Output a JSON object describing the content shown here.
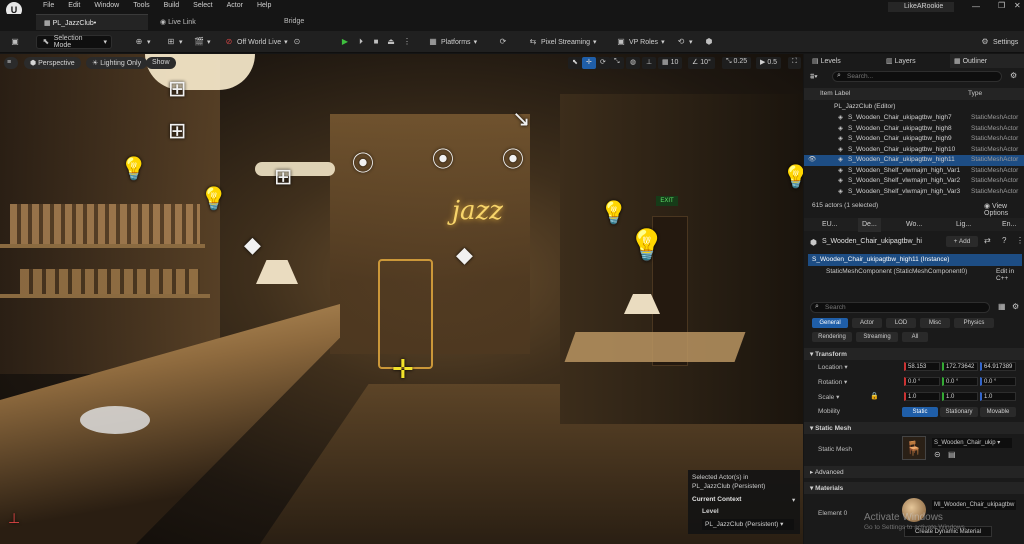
{
  "menu": [
    "File",
    "Edit",
    "Window",
    "Tools",
    "Build",
    "Select",
    "Actor",
    "Help"
  ],
  "window": {
    "project_label": "LikeARookie",
    "tab_level": "PL_JazzClub•",
    "tab_livelink": "Live Link",
    "tab_bridge": "Bridge"
  },
  "toolbar": {
    "selection_mode": "Selection Mode",
    "off_world": "Off World Live",
    "platforms": "Platforms",
    "pixel_streaming": "Pixel Streaming",
    "vp_roles": "VP Roles",
    "settings": "Settings"
  },
  "viewport": {
    "perspective": "Perspective",
    "lighting": "Lighting Only",
    "show": "Show",
    "grid": "10",
    "angle": "10°",
    "scale": "0.25",
    "speed": "0.5",
    "neon_text": "jazz",
    "exit_sign": "EXIT"
  },
  "panel_tabs": {
    "levels": "Levels",
    "layers": "Layers",
    "outliner": "Outliner"
  },
  "outliner": {
    "search_placeholder": "Search...",
    "col_label": "Item Label",
    "col_type": "Type",
    "root": "PL_JazzClub (Editor)",
    "items": [
      {
        "name": "S_Wooden_Chair_ukipagtbw_high7",
        "type": "StaticMeshActor"
      },
      {
        "name": "S_Wooden_Chair_ukipagtbw_high8",
        "type": "StaticMeshActor"
      },
      {
        "name": "S_Wooden_Chair_ukipagtbw_high9",
        "type": "StaticMeshActor"
      },
      {
        "name": "S_Wooden_Chair_ukipagtbw_high10",
        "type": "StaticMeshActor"
      },
      {
        "name": "S_Wooden_Chair_ukipagtbw_high11",
        "type": "StaticMeshActor"
      },
      {
        "name": "S_Wooden_Shelf_vlwmajm_high_Var1",
        "type": "StaticMeshActor"
      },
      {
        "name": "S_Wooden_Shelf_vlwmajm_high_Var2",
        "type": "StaticMeshActor"
      },
      {
        "name": "S_Wooden_Shelf_vlwmajm_high_Var3",
        "type": "StaticMeshActor"
      }
    ],
    "footer": "615 actors (1 selected)"
  },
  "details_tabs": [
    "EU...",
    "De...",
    "Wo...",
    "Lig...",
    "En..."
  ],
  "details": {
    "actor": "S_Wooden_Chair_ukipagtbw_hi",
    "add": "+ Add",
    "instance": "S_Wooden_Chair_ukipagtbw_high11 (Instance)",
    "component": "StaticMeshComponent (StaticMeshComponent0)",
    "edit_cpp": "Edit in C++",
    "search_placeholder": "Search",
    "filters1": [
      "General",
      "Actor",
      "LOD",
      "Misc",
      "Physics"
    ],
    "filters2": [
      "Rendering",
      "Streaming",
      "All"
    ],
    "transform": "Transform",
    "location": "Location",
    "rotation": "Rotation",
    "scale": "Scale",
    "loc": [
      "58.153",
      "172.73642",
      "64.917389"
    ],
    "rot": [
      "0.0 °",
      "0.0 °",
      "0.0 °"
    ],
    "scl": [
      "1.0",
      "1.0",
      "1.0"
    ],
    "mobility": "Mobility",
    "mob_opts": [
      "Static",
      "Stationary",
      "Movable"
    ],
    "static_mesh_sect": "Static Mesh",
    "static_mesh": "Static Mesh",
    "mesh_value": "S_Wooden_Chair_ukip",
    "advanced": "Advanced",
    "materials": "Materials",
    "element0": "Element 0",
    "material_value": "MI_Wooden_Chair_ukipagtbw",
    "create_dyn": "Create Dynamic Material"
  },
  "context": {
    "selected": "Selected Actor(s) in",
    "selected2": "PL_JazzClub (Persistent)",
    "current": "Current Context",
    "level": "Level",
    "level_value": "PL_JazzClub (Persistent)"
  },
  "watermark": {
    "line1": "Activate Windows",
    "line2": "Go to Settings to activate Windows."
  }
}
